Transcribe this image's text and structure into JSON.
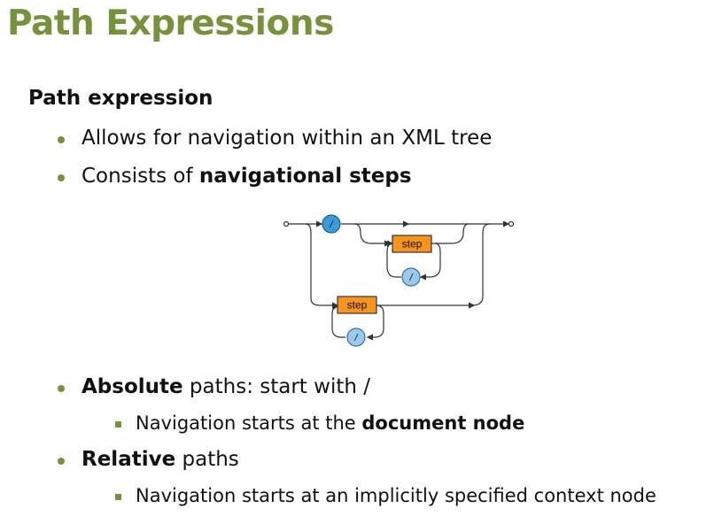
{
  "slide": {
    "title": "Path Expressions",
    "heading": "Path expression",
    "bullets": [
      {
        "text": "Allows for navigation within an XML tree"
      },
      {
        "prefix": "Consists of ",
        "bold": "navigational steps"
      }
    ],
    "absolute": {
      "bold": "Absolute",
      "rest": " paths: start with /",
      "sub_prefix": "Navigation starts at the ",
      "sub_bold": "document node"
    },
    "relative": {
      "bold": "Relative",
      "rest": " paths",
      "sub": "Navigation starts at an implicitly specified context node"
    }
  },
  "diagram": {
    "step_label": "step",
    "slash_label": "/",
    "box_color": "#f7941d",
    "circle_dark": "#3b9ad9",
    "circle_light": "#9cc9ef"
  },
  "colors": {
    "accent": "#76923c"
  }
}
